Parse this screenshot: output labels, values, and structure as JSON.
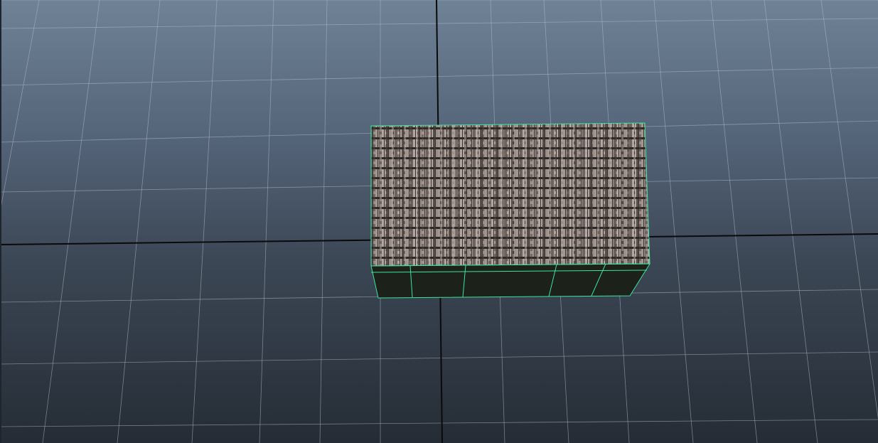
{
  "viewport": {
    "background_top_color": "#6f8296",
    "background_bottom_color": "#252c35",
    "grid_line_color": "#b7c0cb",
    "axis_line_color": "#0a0a0a",
    "selection_highlight_color": "#3fe3a0"
  },
  "selected_object": {
    "shape": "box",
    "texture": "wood-shingle-roof",
    "side_color": "#1c211a",
    "selected": true
  }
}
